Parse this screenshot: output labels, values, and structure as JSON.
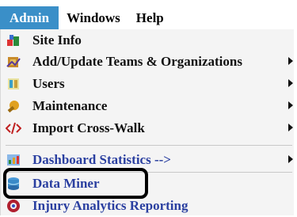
{
  "menubar": {
    "items": [
      {
        "label": "Admin"
      },
      {
        "label": "Windows"
      },
      {
        "label": "Help"
      }
    ]
  },
  "dropdown": {
    "items": [
      {
        "label": "Site Info",
        "icon": "site-info-icon",
        "submenu": false
      },
      {
        "label": "Add/Update Teams & Organizations",
        "icon": "teams-icon",
        "submenu": true
      },
      {
        "label": "Users",
        "icon": "users-icon",
        "submenu": true
      },
      {
        "label": "Maintenance",
        "icon": "wrench-icon",
        "submenu": true
      },
      {
        "label": "Import Cross-Walk",
        "icon": "code-icon",
        "submenu": true
      },
      {
        "label": "Dashboard Statistics -->",
        "icon": "dashboard-icon",
        "submenu": true
      },
      {
        "label": "Data Miner",
        "icon": "data-miner-icon",
        "submenu": false
      },
      {
        "label": "Injury Analytics Reporting",
        "icon": "analytics-icon",
        "submenu": false
      }
    ]
  },
  "colors": {
    "active_menu_bg": "#3a8fc8",
    "link_blue": "#2a3fa0",
    "menu_bg": "#f4f4f4"
  }
}
